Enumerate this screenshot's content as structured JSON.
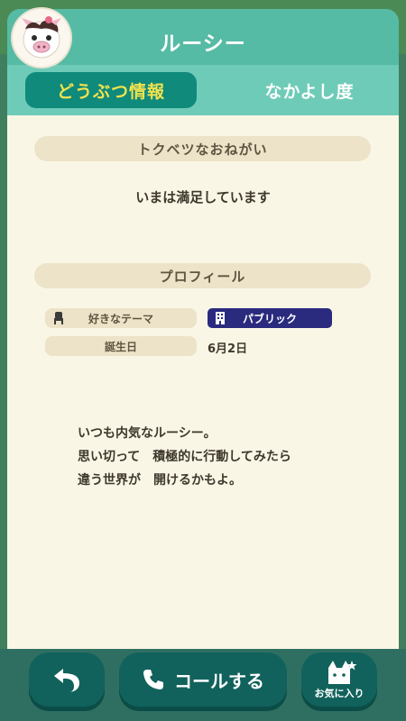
{
  "header": {
    "title": "ルーシー"
  },
  "tabs": [
    {
      "label": "どうぶつ情報",
      "active": true
    },
    {
      "label": "なかよし度",
      "active": false
    }
  ],
  "wish": {
    "heading": "トクベツなおねがい",
    "text": "いまは満足しています"
  },
  "profile": {
    "heading": "プロフィール",
    "favorite_theme_label": "好きなテーマ",
    "favorite_theme_value": "パブリック",
    "birthday_label": "誕生日",
    "birthday_value": "6月2日"
  },
  "quote": {
    "line1": "いつも内気なルーシー。",
    "line2": "思い切って　積極的に行動してみたら",
    "line3": "違う世界が　開けるかもよ。"
  },
  "actions": {
    "back_icon": "back-arrow-icon",
    "call_label": "コールする",
    "favorite_label": "お気に入り"
  },
  "colors": {
    "header": "#55bba4",
    "tab_active": "#0f8a7b",
    "tab_active_text": "#f2e24d",
    "panel": "#faf6e6",
    "button": "#11625c",
    "theme_badge": "#2a2a7e"
  }
}
